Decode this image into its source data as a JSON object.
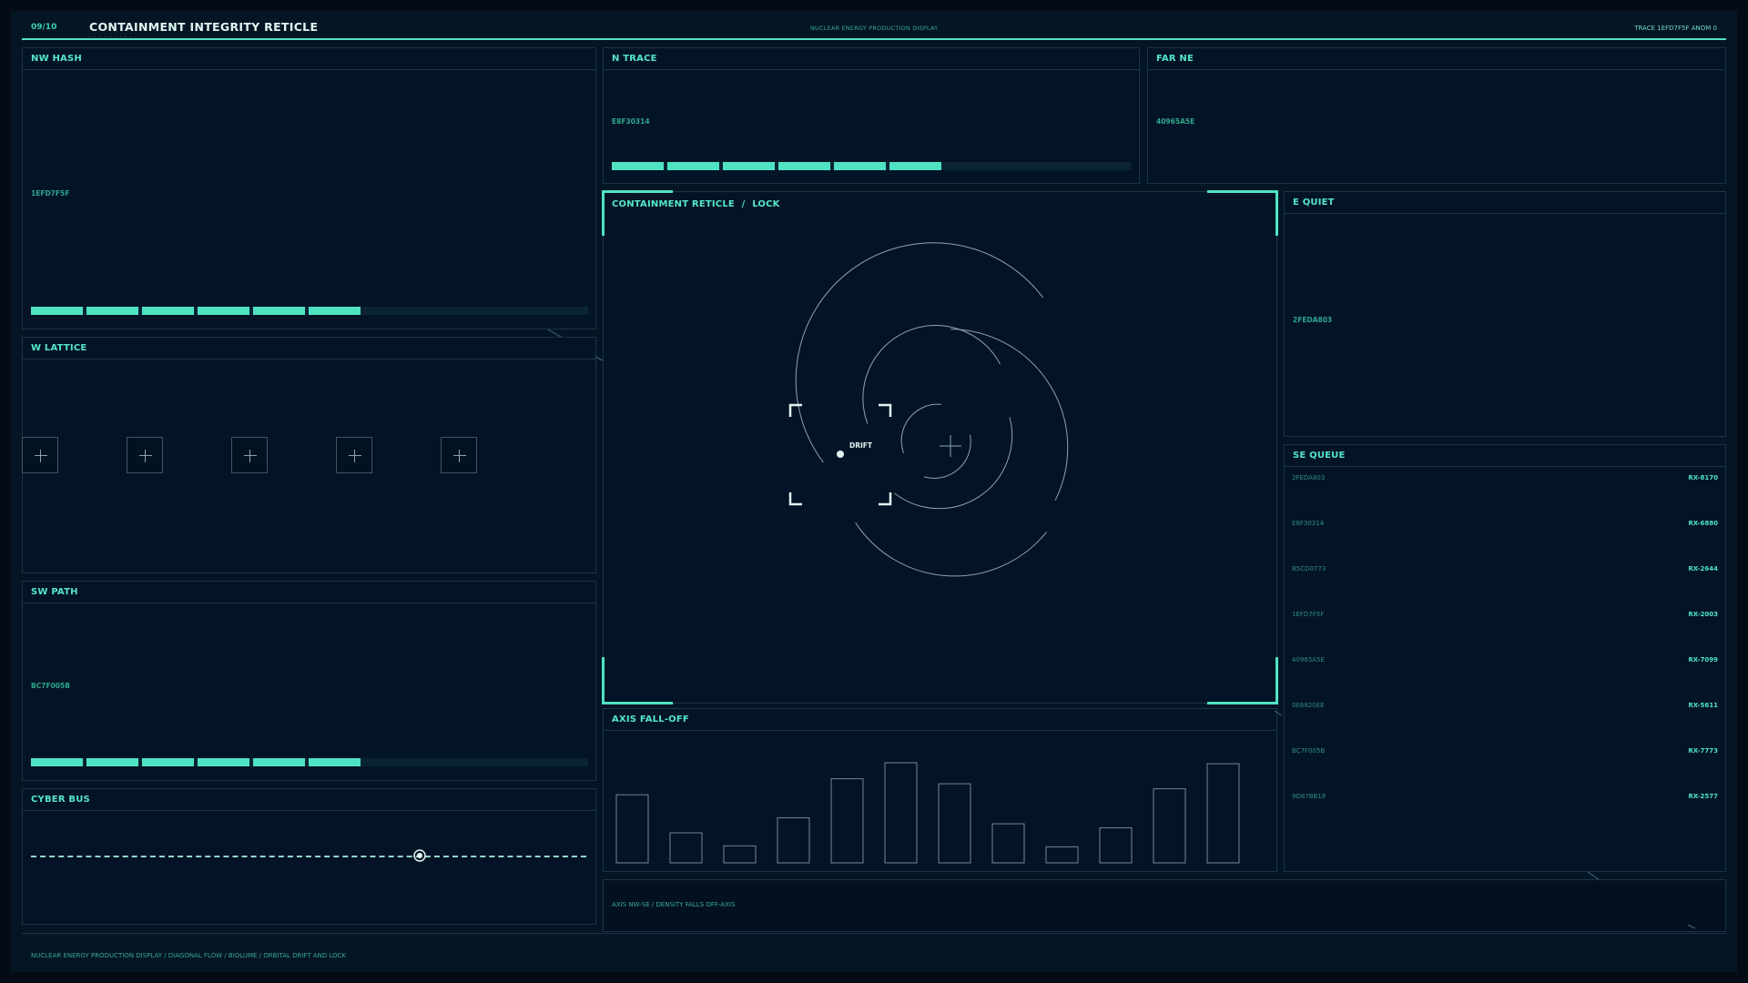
{
  "header": {
    "index": "09/10",
    "title": "CONTAINMENT INTEGRITY RETICLE",
    "center": "NUCLEAR ENERGY PRODUCTION DISPLAY",
    "right": "TRACE 1EFD7F5F  ANOM 0"
  },
  "panels": {
    "nw_hash": {
      "title": "NW HASH",
      "hash": "1EFD7F5F",
      "segments": 6
    },
    "n_trace": {
      "title": "N TRACE",
      "hash": "E8F30314",
      "segments": 6
    },
    "far_ne": {
      "title": "FAR NE",
      "hash": "40965A5E"
    },
    "w_lattice": {
      "title": "W LATTICE"
    },
    "sw_path": {
      "title": "SW PATH",
      "hash": "BC7F005B",
      "segments": 6
    },
    "cyber_bus": {
      "title": "CYBER BUS",
      "marker_position": 0.7
    },
    "reticle": {
      "title": "CONTAINMENT RETICLE",
      "sep": "/",
      "mode": "LOCK",
      "drift_label": "DRIFT"
    },
    "e_quiet": {
      "title": "E QUIET",
      "hash": "2FEDA803"
    },
    "se_queue": {
      "title": "SE QUEUE",
      "rows": [
        {
          "id": "2FEDA803",
          "value": "RX-8170"
        },
        {
          "id": "E8F30314",
          "value": "RX-6880"
        },
        {
          "id": "B5CD0773",
          "value": "RX-2644"
        },
        {
          "id": "1EFD7F5F",
          "value": "RX-2003"
        },
        {
          "id": "40965A5E",
          "value": "RX-7099"
        },
        {
          "id": "0E6820EE",
          "value": "RX-5611"
        },
        {
          "id": "BC7F005B",
          "value": "RX-7773"
        },
        {
          "id": "9D87BB18",
          "value": "RX-2577"
        }
      ]
    },
    "axis_falloff": {
      "title": "AXIS FALL-OFF",
      "bars": [
        0.68,
        0.3,
        0.17,
        0.45,
        0.84,
        1.0,
        0.79,
        0.39,
        0.16,
        0.35,
        0.74,
        0.99
      ]
    }
  },
  "footer": {
    "axis_note": "AXIS NW-SE  /  DENSITY FALLS OFF-AXIS",
    "bottom": "NUCLEAR ENERGY PRODUCTION DISPLAY  /  DIAGONAL FLOW  /  BIOLUME  /  ORBITAL DRIFT AND LOCK"
  },
  "colors": {
    "accent": "#4fe3c1",
    "background": "#030c14",
    "panel": "#041427",
    "border": "#1b3448"
  }
}
